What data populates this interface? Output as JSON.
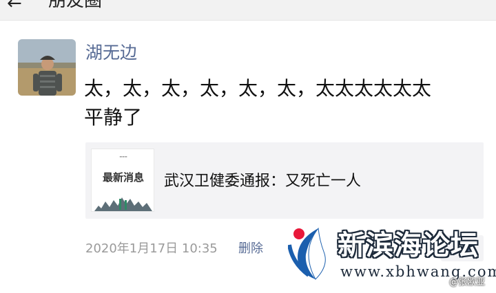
{
  "header": {
    "back_symbol": "←",
    "title": "朋友圈"
  },
  "post": {
    "author": "湖无边",
    "text_line1": "太，太，太，太，太，太，太太太太太太",
    "text_line2": "平静了",
    "share": {
      "thumb_title": "最新消息",
      "title": "武汉卫健委通报：又死亡一人"
    },
    "timestamp": "2020年1月17日 10:35",
    "delete_label": "删除"
  },
  "watermark": {
    "site_name": "新滨海论坛",
    "url": "www.xbhwang.com",
    "weibo_handle": "@张欧亚"
  },
  "colors": {
    "link": "#576b95",
    "card_bg": "#f3f3f5",
    "logo_red": "#e8183a",
    "logo_blue": "#1b5fae"
  }
}
